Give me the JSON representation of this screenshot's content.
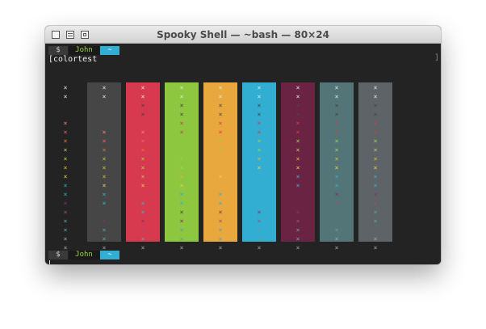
{
  "window": {
    "title": "Spooky Shell — ~bash — 80×24"
  },
  "prompt": {
    "dollar": "$",
    "user": "John",
    "dir": "~"
  },
  "command": "colortest",
  "right_bracket": "]",
  "left_bracket": "[",
  "mark": "×",
  "colors": {
    "terminal_bg": "#232323",
    "prompt_user": "#9bd23f",
    "prompt_dir": "#32aed3"
  },
  "columns": [
    {
      "bg": "#232323",
      "marks": [
        "#e0e0e0",
        "#e0e0e0",
        "",
        "#232323",
        "#f08080",
        "#f06060",
        "#e07030",
        "#9bd23f",
        "#b0d040",
        "#e5b040",
        "#e0d050",
        "#32aed3",
        "#30b0d0",
        "#8b3060",
        "#a05070",
        "#5ba0a0",
        "#60a0a0",
        "#9aa0a5",
        "#a0a0a0"
      ]
    },
    {
      "bg": "#464646",
      "marks": [
        "#e0e0e0",
        "#e0e0e0",
        "",
        "",
        "",
        "#f08080",
        "#f06060",
        "#e07030",
        "#9bd23f",
        "#b0d040",
        "#e5b040",
        "#e0d050",
        "#32aed3",
        "#30b0d0",
        "",
        "#8b3060",
        "#5ba0a0",
        "#60a0a0",
        "#9aa0a5"
      ]
    },
    {
      "bg": "#d73a4e",
      "marks": [
        "#e0e0e0",
        "#e0e0e0",
        "#464646",
        "#464646",
        "",
        "#f08080",
        "#f06060",
        "#e07030",
        "#9bd23f",
        "#b0d040",
        "#e5b040",
        "#e0d050",
        "",
        "#32aed3",
        "#30b0d0",
        "#8b3060",
        "#a05070",
        "#5ba0a0",
        "#9aa0a5"
      ]
    },
    {
      "bg": "#8dc63f",
      "marks": [
        "#e0e0e0",
        "#e0e0e0",
        "#464646",
        "#464646",
        "#d73a4e",
        "#d73a4e",
        "",
        "",
        "#9bd23f",
        "#b0d040",
        "#e5b040",
        "#e0d050",
        "#32aed3",
        "#30b0d0",
        "#464646",
        "#8b3060",
        "#5ba0a0",
        "#60a0a0",
        "#9aa0a5"
      ]
    },
    {
      "bg": "#e8a83e",
      "marks": [
        "#e0e0e0",
        "#e0e0e0",
        "#464646",
        "#464646",
        "#d73a4e",
        "#d73a4e",
        "#9bd23f",
        "#9bd23f",
        "",
        "#e5b040",
        "#e0d050",
        "",
        "#32aed3",
        "#30b0d0",
        "#8b3060",
        "#a05070",
        "#5ba0a0",
        "#60a0a0",
        "#9aa0a5"
      ]
    },
    {
      "bg": "#32aed3",
      "marks": [
        "#e0e0e0",
        "#e0e0e0",
        "#464646",
        "#464646",
        "#d73a4e",
        "#d73a4e",
        "#9bd23f",
        "#9bd23f",
        "#e5b040",
        "#e0d050",
        "",
        "",
        "#32aed3",
        "#30b0d0",
        "#8b3060",
        "#a05070",
        "#5ba0a0",
        "#60a0a0",
        "#9aa0a5"
      ]
    },
    {
      "bg": "#6b2344",
      "marks": [
        "#e0e0e0",
        "#e0e0e0",
        "#464646",
        "#464646",
        "#d73a4e",
        "#d73a4e",
        "#9bd23f",
        "#b0d040",
        "#e5b040",
        "#e0d050",
        "#32aed3",
        "#30b0d0",
        "",
        "",
        "#8b3060",
        "#a05070",
        "#5ba0a0",
        "#60a0a0",
        "#9aa0a5"
      ]
    },
    {
      "bg": "#537577",
      "marks": [
        "#e0e0e0",
        "#e0e0e0",
        "#464646",
        "#464646",
        "#d73a4e",
        "#d73a4e",
        "#9bd23f",
        "#b0d040",
        "#e5b040",
        "#e0d050",
        "#32aed3",
        "#30b0d0",
        "#8b3060",
        "#a05070",
        "",
        "",
        "#5ba0a0",
        "#9aa0a5",
        "#a0a0a0"
      ]
    },
    {
      "bg": "#5e6367",
      "marks": [
        "#e0e0e0",
        "#e0e0e0",
        "#464646",
        "#464646",
        "#d73a4e",
        "#d73a4e",
        "#9bd23f",
        "#b0d040",
        "#e5b040",
        "#e0d050",
        "#32aed3",
        "#30b0d0",
        "#8b3060",
        "#a05070",
        "#5ba0a0",
        "#60a0a0",
        "",
        "#9aa0a5",
        "#a0a0a0"
      ]
    }
  ]
}
